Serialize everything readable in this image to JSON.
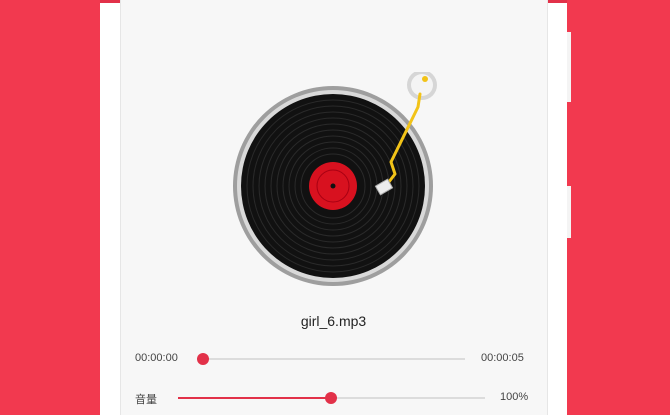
{
  "player": {
    "track_name": "girl_6.mp3",
    "current_time": "00:00:00",
    "total_time": "00:00:05",
    "progress": 0.0
  },
  "volume": {
    "label": "音量",
    "value_text": "100%",
    "level": 0.5
  },
  "colors": {
    "background": "#f2394f",
    "accent": "#e23149",
    "tonearm": "#f2c318"
  },
  "icons": {
    "record": "vinyl-record-icon",
    "tonearm": "tonearm-icon"
  }
}
